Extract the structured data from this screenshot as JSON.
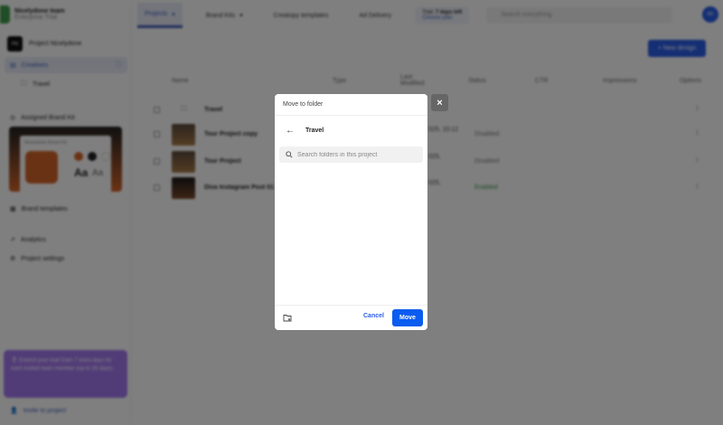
{
  "sidebar": {
    "team_name": "Nicelydone team",
    "plan": "Enterprise Trial",
    "project_initials": "PN",
    "project_name": "Project Nicelydone",
    "creatives": "Creatives",
    "folder": "Travel",
    "assigned_brand_kit": "Assigned Brand Kit",
    "brand_kit_name": "Nicelydone Brand Kit",
    "font_sample": "Aa",
    "brand_templates": "Brand templates",
    "analytics": "Analytics",
    "project_settings": "Project settings",
    "promo": "🎖 Extend your trial! Earn 7 extra days for each invited team member (up to 28 days).",
    "invite": "Invite to project"
  },
  "topnav": {
    "tabs": [
      "Projects",
      "Brand Kits",
      "Creatopy templates",
      "Ad Delivery"
    ],
    "trial_label": "Trial:",
    "trial_days": "7 days left",
    "choose_plan": "Choose plan",
    "search_placeholder": "Search everything",
    "avatar": "ND"
  },
  "toolbar": {
    "new_design": "+ New design"
  },
  "table": {
    "headers": [
      "Name",
      "Type",
      "Last Modified",
      "Status",
      "CTR",
      "Impressions",
      "Options"
    ],
    "rows": [
      {
        "name": "Travel",
        "status": ""
      },
      {
        "name": "Tour Project copy",
        "status": "Disabled",
        "modified": "025, 10:12"
      },
      {
        "name": "Tour Project",
        "status": "Disabled",
        "modified": "025,"
      },
      {
        "name": "Diva Instagram Post 01",
        "status": "Enabled",
        "modified": "025,"
      }
    ]
  },
  "modal": {
    "title": "Move to folder",
    "current_folder": "Travel",
    "search_placeholder": "Search folders in this project",
    "cancel": "Cancel",
    "move": "Move",
    "close": "×"
  },
  "colors": {
    "accent": "#0b5cf0",
    "brand_orange": "#d4652a",
    "promo": "#a479f0"
  }
}
